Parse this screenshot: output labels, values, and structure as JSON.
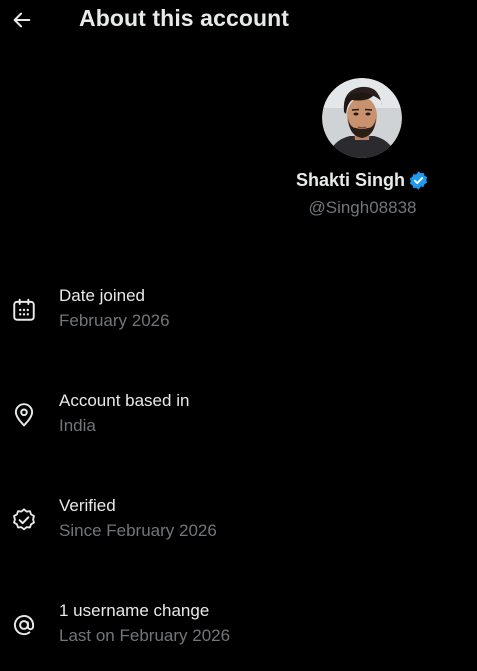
{
  "header": {
    "back_icon": "arrow-left-icon",
    "title": "About this account"
  },
  "profile": {
    "avatar_icon": "user-avatar-photo",
    "display_name": "Shakti Singh",
    "verified_icon": "verified-badge-icon",
    "handle": "@Singh08838"
  },
  "details": [
    {
      "icon": "calendar-icon",
      "title": "Date joined",
      "value": "February 2026"
    },
    {
      "icon": "location-pin-icon",
      "title": "Account based in",
      "value": "India"
    },
    {
      "icon": "verified-check-icon",
      "title": "Verified",
      "value": "Since February 2026"
    },
    {
      "icon": "at-sign-icon",
      "title": "1 username change",
      "value": "Last on February 2026"
    }
  ],
  "colors": {
    "background": "#000000",
    "primary_text": "#e7e9ea",
    "secondary_text": "#71767b",
    "verified_blue": "#1d9bf0"
  }
}
